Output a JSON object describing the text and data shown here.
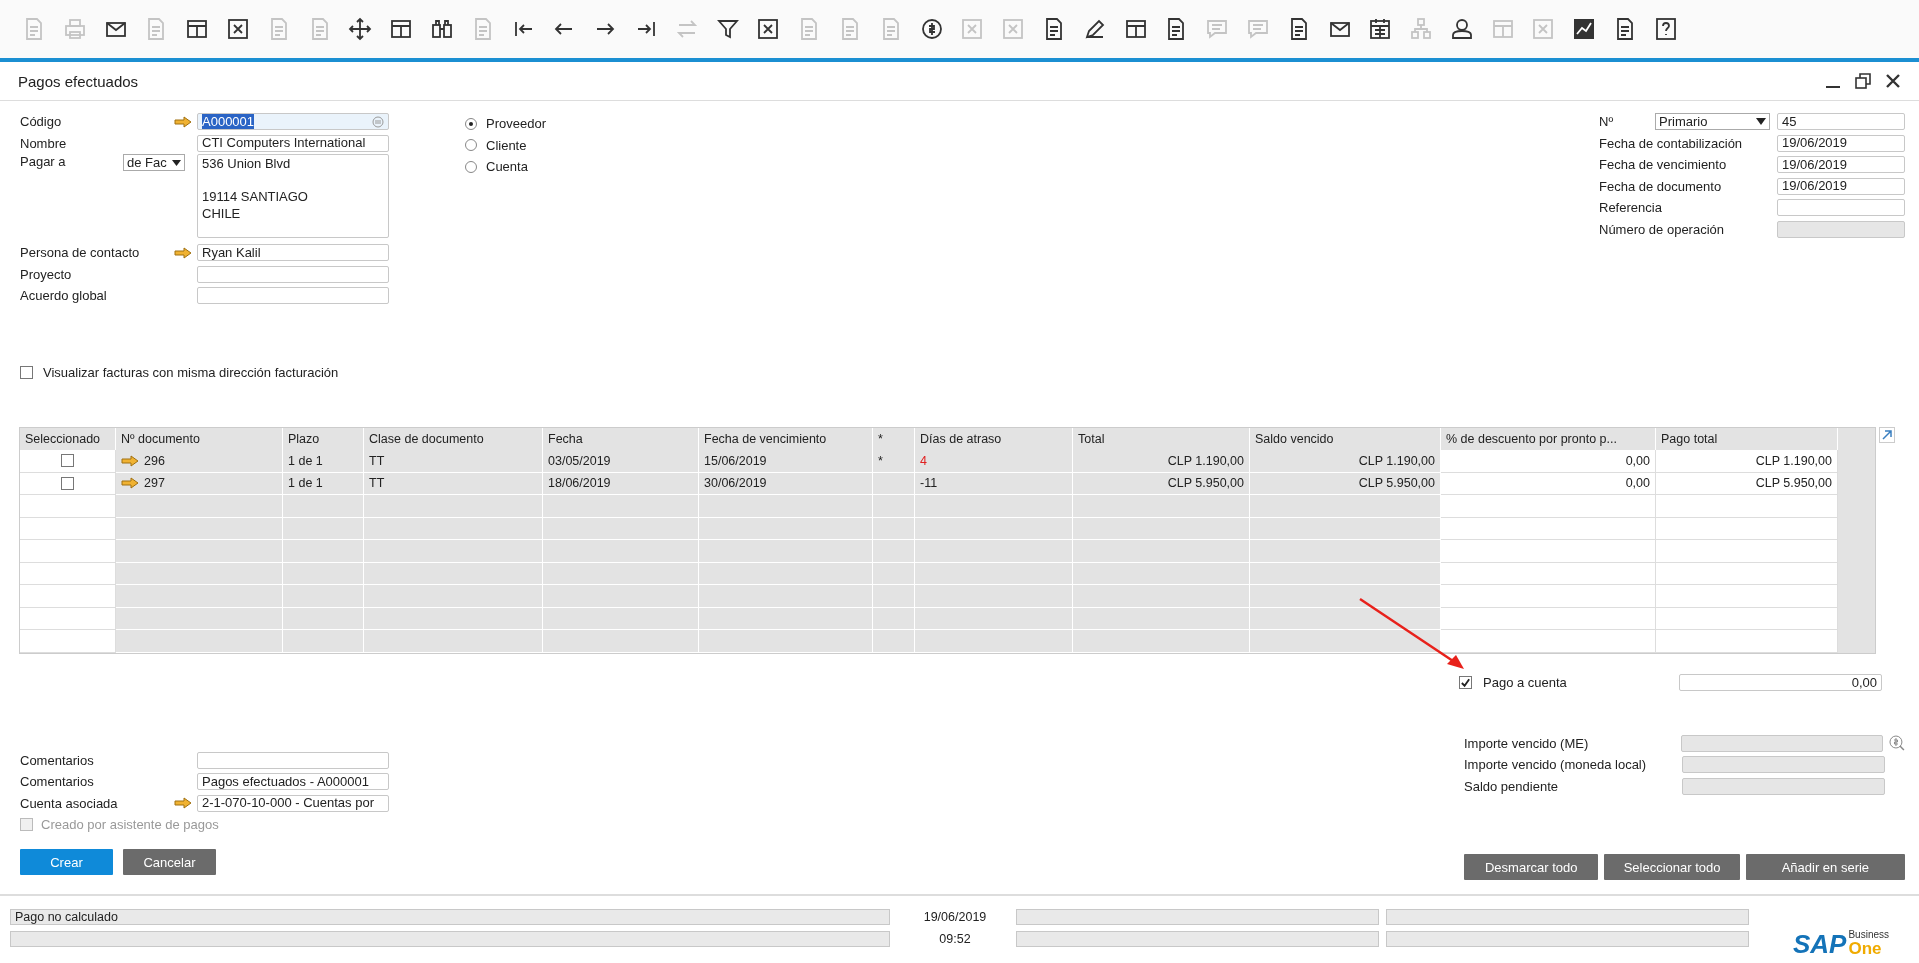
{
  "toolbar": [
    {
      "kind": "doc",
      "disabled": true
    },
    {
      "kind": "printer",
      "disabled": true
    },
    {
      "kind": "envelope",
      "disabled": false
    },
    {
      "kind": "doc",
      "disabled": true
    },
    {
      "kind": "window",
      "disabled": false
    },
    {
      "kind": "sheet",
      "disabled": false
    },
    {
      "kind": "doc",
      "disabled": true
    },
    {
      "kind": "doc",
      "disabled": true
    },
    {
      "kind": "move",
      "disabled": false
    },
    {
      "kind": "window",
      "disabled": false
    },
    {
      "kind": "binoculars",
      "disabled": false
    },
    {
      "kind": "doc",
      "disabled": true
    },
    {
      "kind": "first",
      "disabled": false
    },
    {
      "kind": "left",
      "disabled": false
    },
    {
      "kind": "right",
      "disabled": false
    },
    {
      "kind": "last",
      "disabled": false
    },
    {
      "kind": "swap",
      "disabled": true
    },
    {
      "kind": "funnel",
      "disabled": false
    },
    {
      "kind": "sheet",
      "disabled": false
    },
    {
      "kind": "doc",
      "disabled": true
    },
    {
      "kind": "doc",
      "disabled": true
    },
    {
      "kind": "doc",
      "disabled": true
    },
    {
      "kind": "coin",
      "disabled": false
    },
    {
      "kind": "sheet",
      "disabled": true
    },
    {
      "kind": "sheet",
      "disabled": true
    },
    {
      "kind": "doc",
      "disabled": false
    },
    {
      "kind": "pencil",
      "disabled": false
    },
    {
      "kind": "window",
      "disabled": false
    },
    {
      "kind": "doc",
      "disabled": false
    },
    {
      "kind": "chat",
      "disabled": true
    },
    {
      "kind": "chat",
      "disabled": true
    },
    {
      "kind": "doc",
      "disabled": false
    },
    {
      "kind": "envelope",
      "disabled": false
    },
    {
      "kind": "calendar",
      "disabled": false
    },
    {
      "kind": "tree",
      "disabled": true
    },
    {
      "kind": "person",
      "disabled": false
    },
    {
      "kind": "window",
      "disabled": true
    },
    {
      "kind": "sheet",
      "disabled": true
    },
    {
      "kind": "chart",
      "disabled": false
    },
    {
      "kind": "doc",
      "disabled": false
    },
    {
      "kind": "help",
      "disabled": false
    }
  ],
  "window": {
    "title": "Pagos efectuados"
  },
  "header_left": {
    "codigo": {
      "label": "Código",
      "value": "A000001"
    },
    "nombre": {
      "label": "Nombre",
      "value": "CTI  Computers International"
    },
    "pagar_a": {
      "label": "Pagar a",
      "option": "de Fac",
      "address": [
        "536 Union Blvd",
        "19114 SANTIAGO",
        "CHILE"
      ]
    },
    "contacto": {
      "label": "Persona de contacto",
      "value": "Ryan Kalil"
    },
    "proyecto": {
      "label": "Proyecto"
    },
    "acuerdo": {
      "label": "Acuerdo global"
    }
  },
  "partner_type": [
    {
      "label": "Proveedor",
      "selected": true
    },
    {
      "label": "Cliente",
      "selected": false
    },
    {
      "label": "Cuenta",
      "selected": false
    }
  ],
  "header_right": {
    "numero": {
      "label": "Nº",
      "series": "Primario",
      "value": "45"
    },
    "fields": [
      {
        "label": "Fecha de contabilización",
        "value": "19/06/2019",
        "disabled": false
      },
      {
        "label": "Fecha de vencimiento",
        "value": "19/06/2019",
        "disabled": false
      },
      {
        "label": "Fecha de documento",
        "value": "19/06/2019",
        "disabled": false
      },
      {
        "label": "Referencia",
        "disabled": false
      },
      {
        "label": "Número de operación",
        "disabled": true
      }
    ]
  },
  "same_address": {
    "label": "Visualizar facturas con misma dirección facturación",
    "checked": false
  },
  "table": {
    "columns": [
      "Seleccionado",
      "Nº documento",
      "Plazo",
      "Clase de documento",
      "Fecha",
      "Fecha de vencimiento",
      "*",
      "Días de atraso",
      "Total",
      "Saldo vencido",
      "% de descuento por pronto p...",
      "Pago total"
    ],
    "rows": [
      {
        "selected": false,
        "doc": "296",
        "plazo": "1 de 1",
        "clase": "TT",
        "fecha": "03/05/2019",
        "vencimiento": "15/06/2019",
        "star": "*",
        "dias": "4",
        "overdue": true,
        "total": "CLP 1.190,00",
        "saldo": "CLP 1.190,00",
        "descuento": "0,00",
        "pago": "CLP 1.190,00"
      },
      {
        "selected": false,
        "doc": "297",
        "plazo": "1 de 1",
        "clase": "TT",
        "fecha": "18/06/2019",
        "vencimiento": "30/06/2019",
        "dias": "-11",
        "overdue": false,
        "total": "CLP 5.950,00",
        "saldo": "CLP 5.950,00",
        "descuento": "0,00",
        "pago": "CLP 5.950,00"
      }
    ]
  },
  "pago_a_cuenta": {
    "label": "Pago a cuenta",
    "checked": true,
    "value": "0,00"
  },
  "totals": [
    {
      "label": "Importe vencido (ME)"
    },
    {
      "label": "Importe vencido (moneda local)"
    },
    {
      "label": "Saldo pendiente"
    }
  ],
  "footer_left": {
    "comentarios1": {
      "label": "Comentarios"
    },
    "comentarios2": {
      "label": "Comentarios",
      "value": "Pagos efectuados - A000001"
    },
    "cuenta": {
      "label": "Cuenta asociada",
      "value": "2-1-070-10-000 - Cuentas por"
    },
    "asistente": {
      "label": "Creado por asistente de pagos",
      "checked": false,
      "disabled": true
    }
  },
  "buttons_left": [
    {
      "label": "Crear",
      "primary": true
    },
    {
      "label": "Cancelar",
      "primary": false
    }
  ],
  "buttons_right": [
    "Desmarcar todo",
    "Seleccionar todo",
    "Añadir en serie"
  ],
  "status_bar": {
    "message": "Pago no calculado",
    "date": "19/06/2019",
    "time": "09:52"
  },
  "logo": {
    "name": "SAP",
    "line1": "Business",
    "line2": "One"
  }
}
